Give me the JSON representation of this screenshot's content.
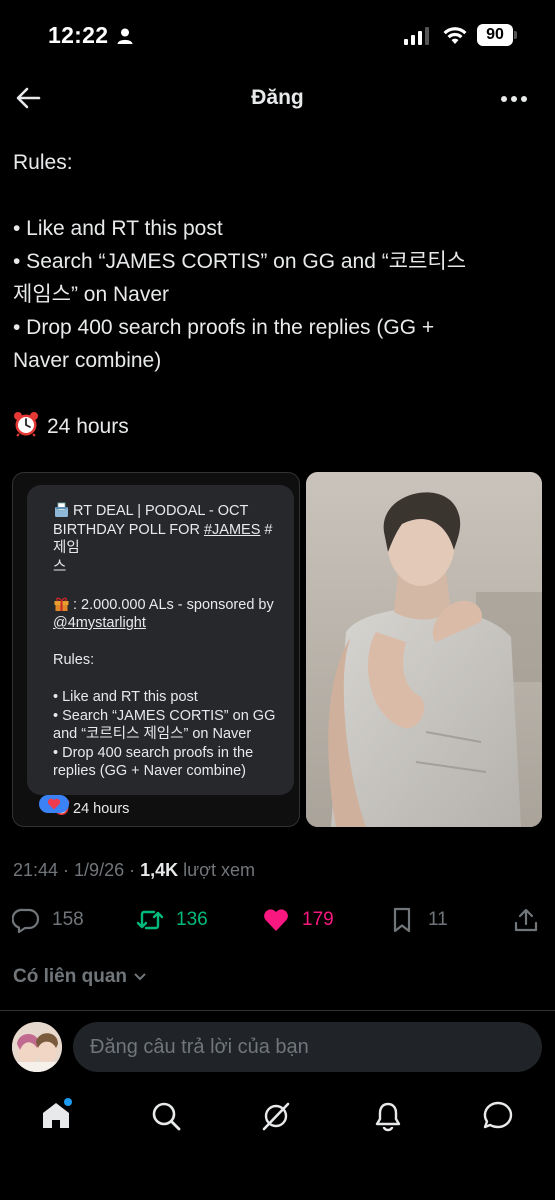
{
  "status_bar": {
    "time": "12:22",
    "battery": "90"
  },
  "nav": {
    "title": "Đăng"
  },
  "tweet": {
    "lines": [
      "Rules:",
      "",
      "• Like and RT this post",
      "• Search “JAMES CORTIS” on GG and “코르티스",
      "제임스” on Naver",
      "• Drop 400 search proofs in the replies (GG +",
      "Naver combine)",
      "",
      "24 hours"
    ]
  },
  "quoted_card": {
    "line1": "RT DEAL | PODOAL - OCT",
    "line2_prefix": "BIRTHDAY POLL FOR ",
    "line2_link": "#JAMES",
    "line2_suffix": " #제임",
    "line3": "스",
    "gift_line_prefix": ": 2.000.000 ALs - sponsored by",
    "gift_link": "@4mystarlight",
    "rules_title": "Rules:",
    "rule1": "• Like and RT this post",
    "rule2a": "• Search “JAMES CORTIS” on GG",
    "rule2b": "and “코르티스 제임스” on Naver",
    "rule3a": "• Drop 400 search proofs in the",
    "rule3b": "replies (GG + Naver combine)",
    "hours": "24 hours"
  },
  "meta": {
    "time": "21:44",
    "sep": " · ",
    "date": "1/9/26",
    "views_count": "1,4K",
    "views_label": " lượt xem"
  },
  "actions": {
    "replies": "158",
    "reposts": "136",
    "likes": "179",
    "bookmarks": "11"
  },
  "related": {
    "label": "Có liên quan"
  },
  "reply": {
    "placeholder": "Đăng câu trả lời của bạn"
  },
  "colors": {
    "background": "#000000",
    "text": "#e7e9ea",
    "muted": "#71767b",
    "repost": "#00ba7c",
    "like": "#f91880",
    "accent": "#1d9bf0"
  },
  "icons": [
    "back-arrow-icon",
    "more-icon",
    "alarm-clock-icon",
    "ballot-box-icon",
    "gift-icon",
    "heart-reaction-icon",
    "reply-icon",
    "repost-icon",
    "like-icon",
    "bookmark-icon",
    "share-icon",
    "chevron-down-icon",
    "home-icon",
    "search-icon",
    "grok-icon",
    "notifications-icon",
    "messages-icon"
  ]
}
